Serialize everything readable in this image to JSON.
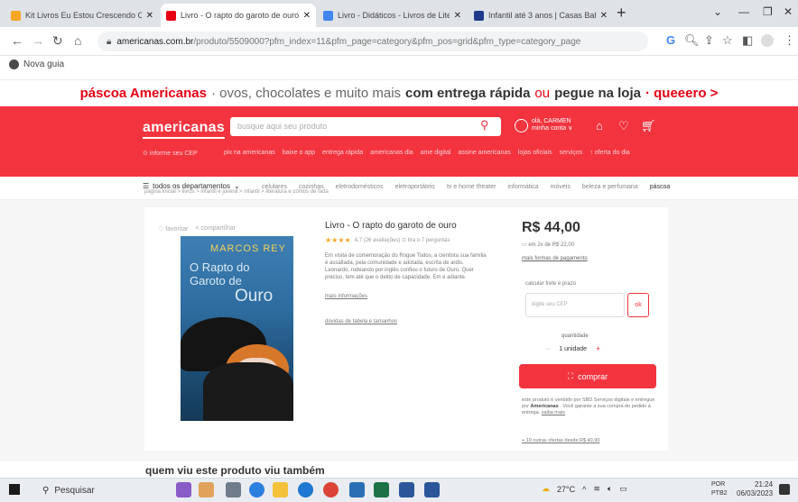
{
  "browser": {
    "tabs": [
      {
        "title": "Kit Livros Eu Estou Crescendo Co",
        "color": "#f5a623"
      },
      {
        "title": "Livro - O rapto do garoto de ouro",
        "color": "#e60014"
      },
      {
        "title": "Livro - Didáticos - Livros de Lite",
        "color": "#4285f4"
      },
      {
        "title": "Infantil até 3 anos | Casas Bahia",
        "color": "#1f3a8a"
      }
    ],
    "url_domain": "americanas.com.br",
    "url_path": "/produto/5509000?pfm_index=11&pfm_page=category&pfm_pos=grid&pfm_type=category_page",
    "bookmark": "Nova guia"
  },
  "promo": {
    "brand": "páscoa Americanas",
    "text": "· ovos, chocolates e muito mais",
    "bold1": "com entrega rápida",
    "or": "ou",
    "bold2": "pegue na loja",
    "cta": "· queeero >"
  },
  "header": {
    "logo": "americanas",
    "search_placeholder": "busque aqui seu produto",
    "user_line1": "olá, CARMEN",
    "user_line2": "minha conta ∨",
    "cep": "⊙ informe seu CEP",
    "links": [
      "pix na americanas",
      "baixe o app",
      "entrega rápida",
      "americanas dia",
      "ame digital",
      "assine americanas",
      "lojas oficiais",
      "serviços",
      "↑ oferta do dia"
    ]
  },
  "nav": {
    "all_categories": "todos os departamentos",
    "categories": [
      "celulares",
      "cozinhas",
      "eletrodomésticos",
      "eletroportáteis",
      "tv e home theater",
      "informática",
      "móveis",
      "beleza e perfumaria",
      "páscoa"
    ]
  },
  "breadcrumb": "página inicial > livros > infantil e juvenil > infantil > literatura e contos de fada",
  "product": {
    "actions": [
      "♡ favoritar",
      "< compartilhar"
    ],
    "cover_author": "MARCOS REY",
    "cover_title1": "O Rapto do",
    "cover_title2": "Garoto de",
    "cover_title3": "Ouro",
    "title": "Livro - O rapto do garoto de ouro",
    "stars": "★★★★",
    "rating": "4,7 (26 avaliações)  ⊙ tira o 7 perguntas",
    "description": "Em visita de comemoração do Rogue Todos, a cientista sua família é assaltada, pela comunidade e adotada, escrita de ardis. Leonardo, rodeando por inglês confiou o futuro de Ouro. Quer preciso, tem até que o delito de capacidade. Em e adiante.",
    "more_info": "mais informações",
    "question": "dúvidas de tabela e tamanhos"
  },
  "buybox": {
    "price": "R$ 44,00",
    "installments": "em 2x de R$ 22,00",
    "payment_link": "mais formas de pagamento",
    "cep_label": "calcular frete e prazo",
    "cep_placeholder": "digite seu CEP",
    "ok_label": "ok",
    "qty_label": "quantidade",
    "qty_value": "1 unidade",
    "buy_label": "comprar",
    "sold_text": "este produto é vendido por SBD Serviços digitais e entregue por",
    "sold_brand": "Americanas",
    "sold_text2": ". Você garante a sua compra do pedido à entrega.",
    "sold_link": "saiba mais",
    "more_sellers": "+ 10 outras ofertas desde R$ 40,90"
  },
  "section_title": "quem viu este produto viu também",
  "taskbar": {
    "search": "Pesquisar",
    "temp": "27°C",
    "lang1": "POR",
    "lang2": "PTB2",
    "time": "21:24",
    "date": "06/03/2023"
  }
}
